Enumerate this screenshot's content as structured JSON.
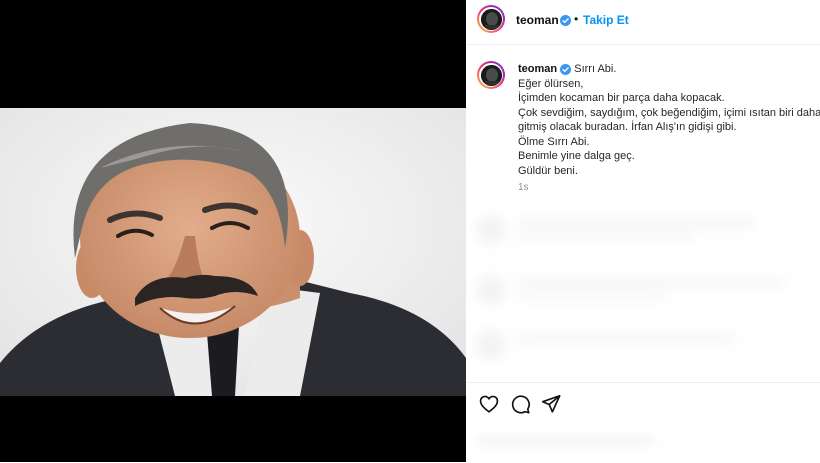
{
  "header": {
    "username": "teoman",
    "separator": "•",
    "follow_label": "Takip Et"
  },
  "post": {
    "caption_user": "teoman",
    "caption_lines": [
      "Sırrı Abi.",
      "Eğer ölürsen,",
      "İçimden kocaman bir parça daha kopacak.",
      "Çok sevdiğim, saydığım, çok beğendiğim, içimi ısıtan biri daha",
      "gitmiş olacak buradan. İrfan Alış'ın gidişi gibi.",
      "Ölme Sırrı Abi.",
      "Benimle yine dalga geç.",
      "Güldür beni."
    ],
    "timestamp": "1s"
  },
  "actions": {
    "icons": [
      "heart-icon",
      "comment-icon",
      "share-icon"
    ]
  },
  "colors": {
    "accent": "#0095f6",
    "verified": "#3897f0"
  }
}
